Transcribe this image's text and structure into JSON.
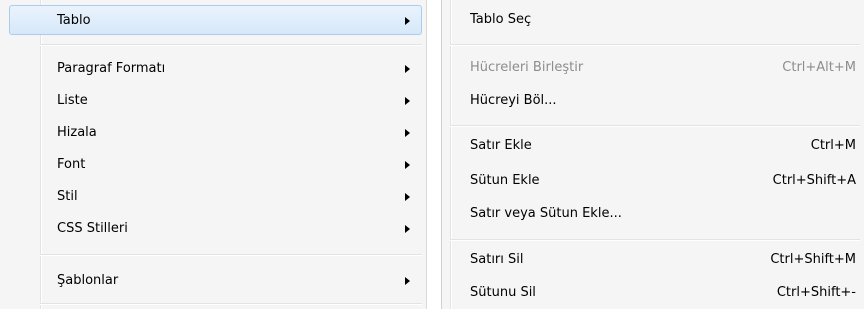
{
  "left_menu": {
    "items": [
      {
        "label": "Tablo",
        "has_submenu": true,
        "highlighted": true
      },
      {
        "label": "Paragraf Formatı",
        "has_submenu": true
      },
      {
        "label": "Liste",
        "has_submenu": true
      },
      {
        "label": "Hizala",
        "has_submenu": true
      },
      {
        "label": "Font",
        "has_submenu": true
      },
      {
        "label": "Stil",
        "has_submenu": true
      },
      {
        "label": "CSS Stilleri",
        "has_submenu": true
      },
      {
        "label": "Şablonlar",
        "has_submenu": true
      }
    ]
  },
  "right_menu": {
    "items": [
      {
        "label": "Tablo Seç",
        "shortcut": ""
      },
      {
        "label": "Hücreleri Birleştir",
        "shortcut": "Ctrl+Alt+M",
        "disabled": true
      },
      {
        "label": "Hücreyi Böl...",
        "shortcut": ""
      },
      {
        "label": "Satır Ekle",
        "shortcut": "Ctrl+M"
      },
      {
        "label": "Sütun Ekle",
        "shortcut": "Ctrl+Shift+A"
      },
      {
        "label": "Satır veya Sütun Ekle...",
        "shortcut": ""
      },
      {
        "label": "Satırı Sil",
        "shortcut": "Ctrl+Shift+M"
      },
      {
        "label": "Sütunu Sil",
        "shortcut": "Ctrl+Shift+-"
      }
    ]
  },
  "icons": {
    "submenu_arrow": "chevron-right-icon"
  },
  "colors": {
    "menu_background": "#f5f5f5",
    "highlight_fill": "#d6e8fa",
    "highlight_border": "#a8cdef",
    "disabled_text": "#8d8d8d"
  }
}
